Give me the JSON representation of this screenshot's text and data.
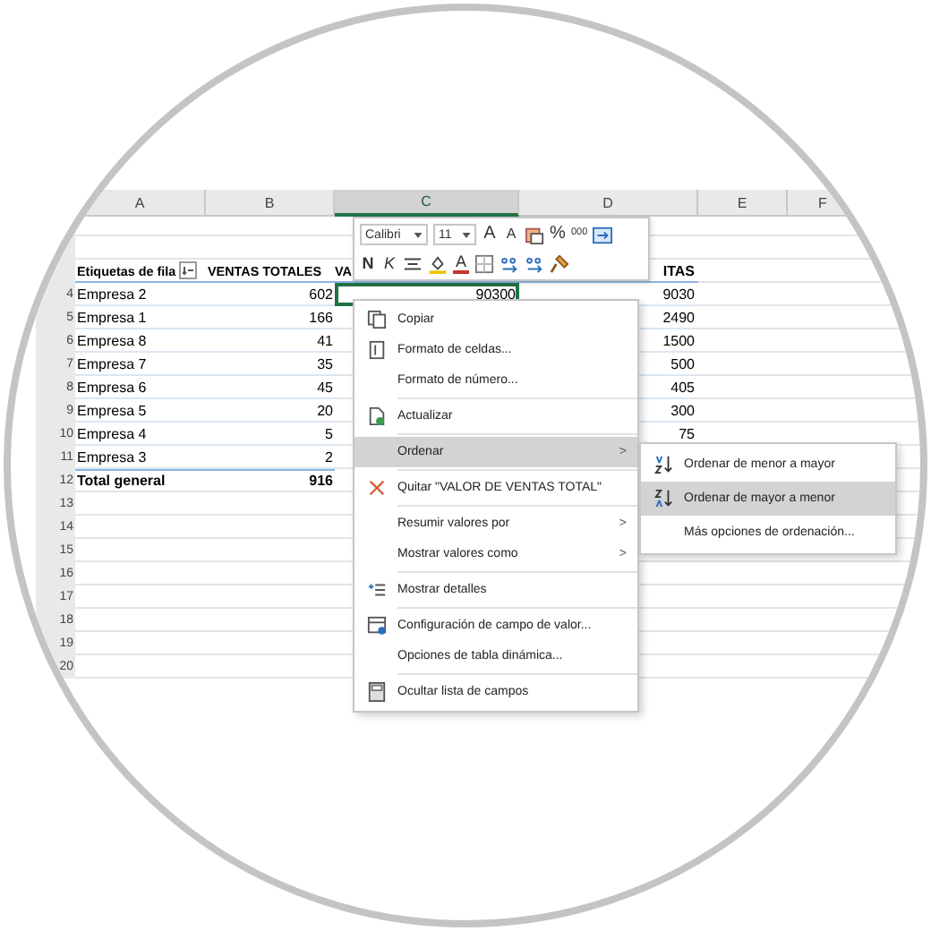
{
  "columns": [
    {
      "letter": "A",
      "selected": false
    },
    {
      "letter": "B",
      "selected": false
    },
    {
      "letter": "C",
      "selected": true
    },
    {
      "letter": "D",
      "selected": false
    },
    {
      "letter": "E",
      "selected": false
    },
    {
      "letter": "F",
      "selected": false
    }
  ],
  "rows": [
    {
      "kind": "header",
      "label": "Etiquetas de fila",
      "total_sales": "VENTAS TOTALES",
      "column_c": "VA",
      "column_d": "ITAS"
    },
    {
      "kind": "data",
      "number": "4",
      "label": "Empresa 2",
      "total_sales": "602",
      "column_c": "90300",
      "column_d": "9030",
      "selected_c": true
    },
    {
      "kind": "data",
      "number": "5",
      "label": "Empresa 1",
      "total_sales": "166",
      "column_d": "2490",
      "selected_c": false
    },
    {
      "kind": "data",
      "number": "6",
      "label": "Empresa 8",
      "total_sales": "41",
      "column_d": "1500",
      "selected_c": false
    },
    {
      "kind": "data",
      "number": "7",
      "label": "Empresa 7",
      "total_sales": "35",
      "column_d": "500",
      "selected_c": false
    },
    {
      "kind": "data",
      "number": "8",
      "label": "Empresa 6",
      "total_sales": "45",
      "column_d": "405",
      "selected_c": false
    },
    {
      "kind": "data",
      "number": "9",
      "label": "Empresa 5",
      "total_sales": "20",
      "column_d": "300",
      "selected_c": false
    },
    {
      "kind": "data",
      "number": "10",
      "label": "Empresa 4",
      "total_sales": "5",
      "column_d": "75",
      "selected_c": false
    },
    {
      "kind": "data",
      "number": "11",
      "label": "Empresa 3",
      "total_sales": "2",
      "selected_c": false
    },
    {
      "kind": "total",
      "number": "12",
      "label": "Total general",
      "total_sales": "916"
    },
    {
      "kind": "empty",
      "number": "13"
    },
    {
      "kind": "empty",
      "number": "14"
    },
    {
      "kind": "empty",
      "number": "15"
    },
    {
      "kind": "empty",
      "number": "16"
    },
    {
      "kind": "empty",
      "number": "17"
    },
    {
      "kind": "empty",
      "number": "18"
    },
    {
      "kind": "empty",
      "number": "19"
    },
    {
      "kind": "empty",
      "number": "20"
    }
  ],
  "mini_toolbar": {
    "font": "Calibri",
    "size": "11",
    "row_1": [
      {
        "kind": "grow",
        "label": "A"
      },
      {
        "kind": "shrink",
        "label": "A"
      },
      {
        "kind": "format"
      },
      {
        "kind": "text",
        "label": "%"
      },
      {
        "kind": "small_text",
        "label": "000"
      },
      {
        "kind": "wrap"
      }
    ],
    "row_2": [
      {
        "kind": "bold",
        "label": "N"
      },
      {
        "kind": "italic",
        "label": "K"
      },
      {
        "kind": "align"
      },
      {
        "kind": "fill"
      },
      {
        "kind": "font_color",
        "label": "A"
      },
      {
        "kind": "border"
      },
      {
        "kind": "decimal"
      },
      {
        "kind": "decimal"
      },
      {
        "kind": "brush"
      }
    ]
  },
  "context_menu": [
    {
      "kind": "copy",
      "label": "Copiar",
      "submenu": false,
      "selected": false
    },
    {
      "kind": "format",
      "label": "Formato de celdas...",
      "submenu": false,
      "selected": false
    },
    {
      "kind": "plain",
      "label": "Formato de número...",
      "submenu": false,
      "selected": false
    },
    {
      "kind": "separator"
    },
    {
      "kind": "refresh",
      "label": "Actualizar",
      "submenu": false,
      "selected": false
    },
    {
      "kind": "separator"
    },
    {
      "kind": "plain",
      "label": "Ordenar",
      "submenu": true,
      "selected": true
    },
    {
      "kind": "separator"
    },
    {
      "kind": "remove",
      "label": "Quitar \"VALOR DE VENTAS TOTAL\"",
      "submenu": false,
      "selected": false
    },
    {
      "kind": "separator"
    },
    {
      "kind": "plain",
      "label": "Resumir valores por",
      "submenu": true,
      "selected": false
    },
    {
      "kind": "plain",
      "label": "Mostrar valores como",
      "submenu": true,
      "selected": false
    },
    {
      "kind": "separator"
    },
    {
      "kind": "details",
      "label": "Mostrar detalles",
      "submenu": false,
      "selected": false
    },
    {
      "kind": "separator"
    },
    {
      "kind": "settings",
      "label": "Configuración de campo de valor...",
      "submenu": false,
      "selected": false
    },
    {
      "kind": "plain",
      "label": "Opciones de tabla dinámica...",
      "submenu": false,
      "selected": false
    },
    {
      "kind": "separator"
    },
    {
      "kind": "fieldlist",
      "label": "Ocultar lista de campos",
      "submenu": false,
      "selected": false
    }
  ],
  "submenu_arrow": ">",
  "sort_submenu": [
    {
      "kind": "ascending",
      "label": "Ordenar de menor a mayor",
      "selected": false
    },
    {
      "kind": "descending",
      "label": "Ordenar de mayor a menor",
      "selected": true
    },
    {
      "kind": "plain",
      "label": "Más opciones de ordenación...",
      "selected": false
    }
  ]
}
